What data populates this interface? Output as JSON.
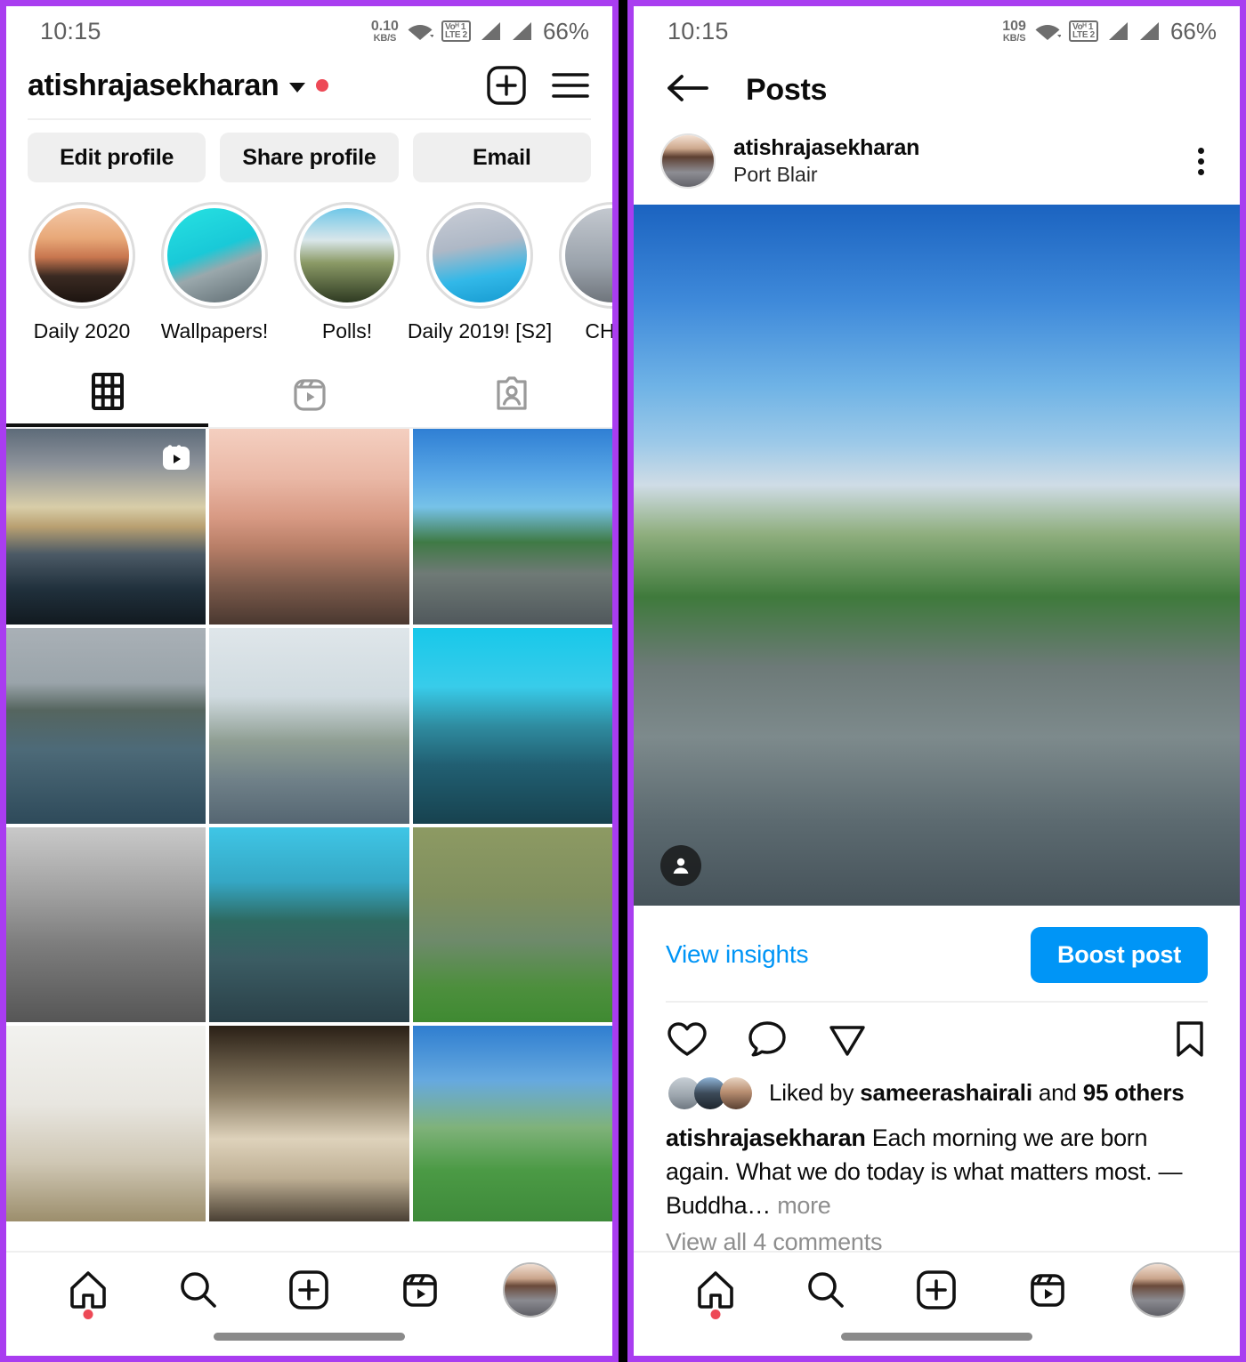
{
  "statusbar": {
    "time": "10:15",
    "left_net_value": "0.10",
    "right_net_value": "109",
    "net_unit": "KB/S",
    "volte_top": "Voᴴ 1",
    "volte_bottom": "LTE 2",
    "battery": "66%"
  },
  "colors": {
    "accent_blue": "#0095F6",
    "highlight_purple": "#B12FF0",
    "border_purple": "#A93DF0",
    "notification_red": "#ED4956",
    "button_grey": "#EFEFEF",
    "muted_text": "#8E8E8E"
  },
  "left_panel": {
    "profile": {
      "username": "atishrajasekharan",
      "has_unread_dot": true,
      "chevron_icon": "chevron-down-icon",
      "new_post_icon": "plus-square-icon",
      "menu_icon": "hamburger-menu-icon"
    },
    "actions": [
      {
        "label": "Edit profile",
        "name": "edit-profile-button"
      },
      {
        "label": "Share profile",
        "name": "share-profile-button"
      },
      {
        "label": "Email",
        "name": "email-button"
      }
    ],
    "highlights": [
      {
        "label": "Daily 2020"
      },
      {
        "label": "Wallpapers!"
      },
      {
        "label": "Polls!"
      },
      {
        "label": "Daily 2019! [S2]"
      },
      {
        "label": "CHIKI"
      }
    ],
    "tabs": [
      {
        "name": "tab-grid",
        "icon": "grid-icon",
        "active": true
      },
      {
        "name": "tab-reels",
        "icon": "reels-icon",
        "active": false
      },
      {
        "name": "tab-tagged",
        "icon": "tagged-person-icon",
        "active": false
      }
    ],
    "grid": [
      {
        "alt": "sunset over sea with dark clouds",
        "is_reel": true,
        "selected": false
      },
      {
        "alt": "pink sunset over beach and boats",
        "is_reel": false,
        "selected": false
      },
      {
        "alt": "man walking on wet road with pigeons",
        "is_reel": false,
        "selected": true
      },
      {
        "alt": "blue fishing boats moored at river",
        "is_reel": false,
        "selected": false
      },
      {
        "alt": "boats under cloudy sky at mangrove",
        "is_reel": false,
        "selected": false
      },
      {
        "alt": "wooden pier bridge under blue sky",
        "is_reel": false,
        "selected": false
      },
      {
        "alt": "black and white portrait of man",
        "is_reel": false,
        "selected": false
      },
      {
        "alt": "winding mountain road",
        "is_reel": false,
        "selected": false
      },
      {
        "alt": "boats on green lake shore",
        "is_reel": false,
        "selected": false
      },
      {
        "alt": "man in mist on hilltop",
        "is_reel": false,
        "selected": false
      },
      {
        "alt": "man framed by cave rocks",
        "is_reel": false,
        "selected": false
      },
      {
        "alt": "wet country road with trees",
        "is_reel": false,
        "selected": false
      }
    ]
  },
  "right_panel": {
    "header": {
      "back_icon": "back-arrow-icon",
      "title": "Posts"
    },
    "post": {
      "author": "atishrajasekharan",
      "location": "Port Blair",
      "more_icon": "kebab-menu-icon",
      "tagged_icon": "tagged-person-icon",
      "photo_alt": "man walking on wet street with pigeons, power lines and birds"
    },
    "insights": {
      "view_insights_label": "View insights",
      "boost_label": "Boost post"
    },
    "actions": {
      "like_icon": "heart-icon",
      "comment_icon": "comment-bubble-icon",
      "share_icon": "send-paper-plane-icon",
      "save_icon": "bookmark-icon"
    },
    "likes": {
      "prefix": "Liked by ",
      "user": "sameerashairali",
      "middle": " and ",
      "others": "95 others"
    },
    "caption": {
      "author": "atishrajasekharan",
      "text": " Each morning we are born again. What we do today is what matters most. —Buddha… ",
      "more_label": "more"
    },
    "comments_label": "View all 4 comments"
  },
  "bottom_nav": [
    {
      "name": "nav-home",
      "icon": "home-icon",
      "badge": true
    },
    {
      "name": "nav-search",
      "icon": "search-icon",
      "badge": false
    },
    {
      "name": "nav-create",
      "icon": "plus-square-icon",
      "badge": false
    },
    {
      "name": "nav-reels",
      "icon": "reels-icon",
      "badge": false
    },
    {
      "name": "nav-profile",
      "icon": "avatar-icon",
      "badge": false
    }
  ]
}
